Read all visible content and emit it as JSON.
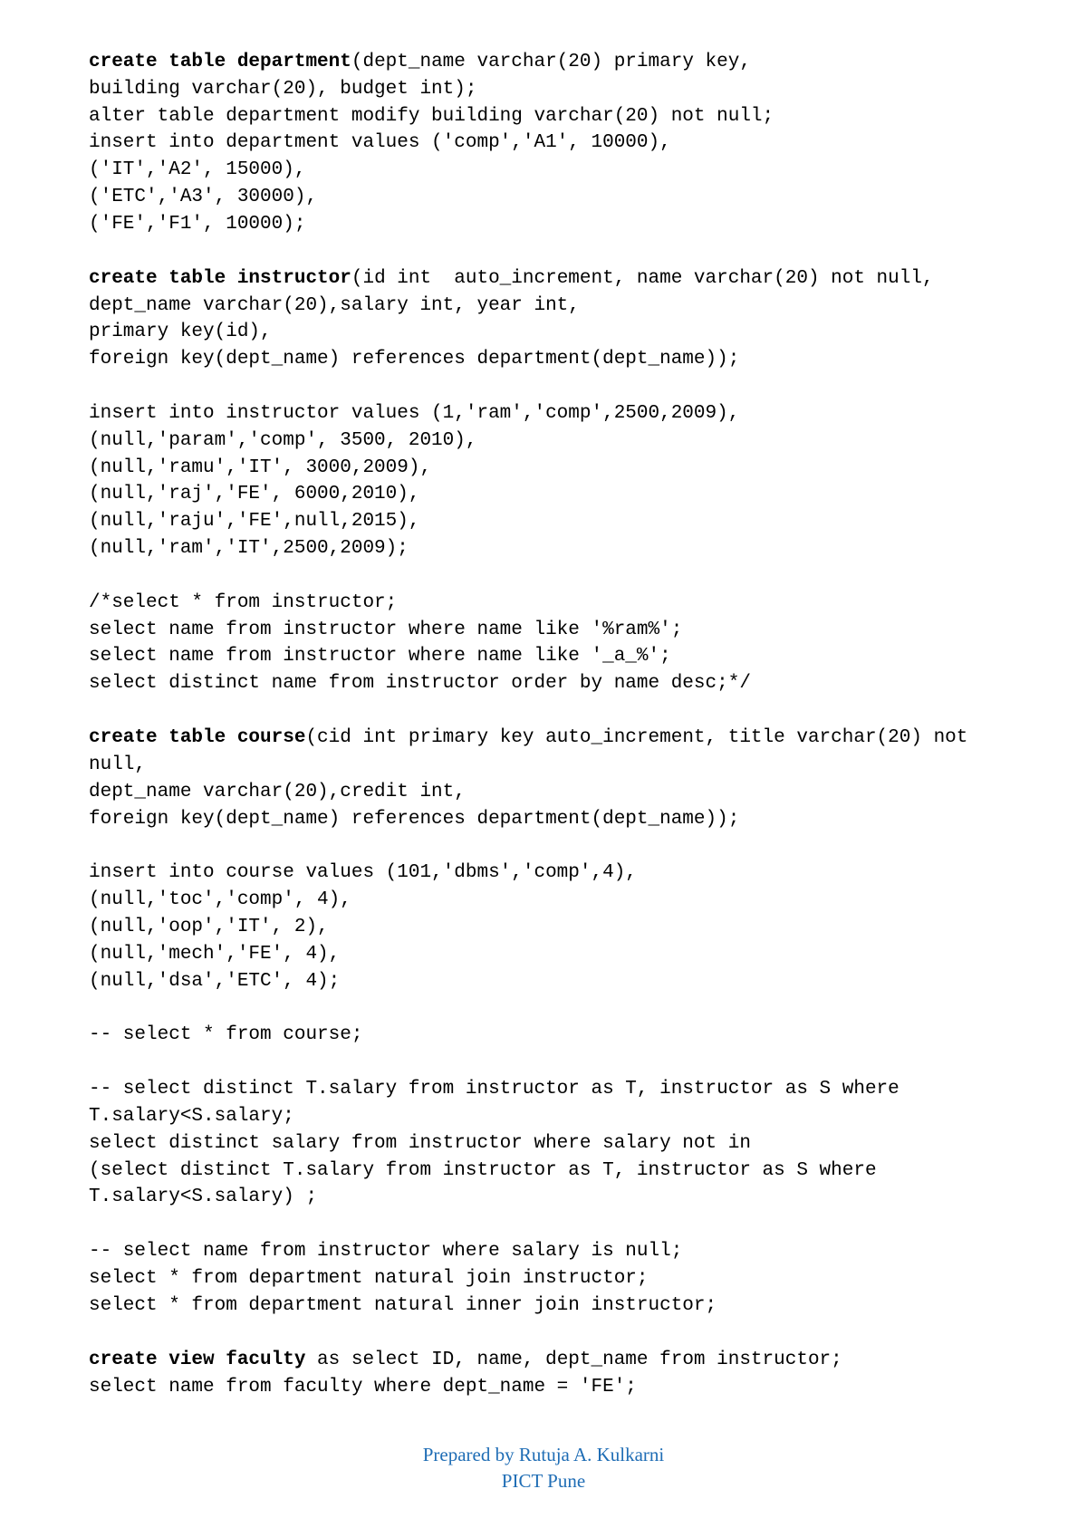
{
  "blocks": {
    "b1_bold": "create table department",
    "b1_rest": "(dept_name varchar(20) primary key,\nbuilding varchar(20), budget int);\nalter table department modify building varchar(20) not null;\ninsert into department values ('comp','A1', 10000),\n('IT','A2', 15000),\n('ETC','A3', 30000),\n('FE','F1', 10000);",
    "b2_bold": "create table instructor",
    "b2_rest": "(id int  auto_increment, name varchar(20) not null,\ndept_name varchar(20),salary int, year int,\nprimary key(id),\nforeign key(dept_name) references department(dept_name));",
    "b3": "insert into instructor values (1,'ram','comp',2500,2009),\n(null,'param','comp', 3500, 2010),\n(null,'ramu','IT', 3000,2009),\n(null,'raj','FE', 6000,2010),\n(null,'raju','FE',null,2015),\n(null,'ram','IT',2500,2009);",
    "b4": "/*select * from instructor;\nselect name from instructor where name like '%ram%';\nselect name from instructor where name like '_a_%';\nselect distinct name from instructor order by name desc;*/",
    "b5_bold": "create table course",
    "b5_rest": "(cid int primary key auto_increment, title varchar(20) not null,\ndept_name varchar(20),credit int,\nforeign key(dept_name) references department(dept_name));",
    "b6": "insert into course values (101,'dbms','comp',4),\n(null,'toc','comp', 4),\n(null,'oop','IT', 2),\n(null,'mech','FE', 4),\n(null,'dsa','ETC', 4);",
    "b7": "-- select * from course;",
    "b8": "-- select distinct T.salary from instructor as T, instructor as S where T.salary<S.salary;\nselect distinct salary from instructor where salary not in\n(select distinct T.salary from instructor as T, instructor as S where\nT.salary<S.salary) ;",
    "b9": "-- select name from instructor where salary is null;\nselect * from department natural join instructor;\nselect * from department natural inner join instructor;",
    "b10_bold": "create view faculty",
    "b10_rest": " as select ID, name, dept_name from instructor;\nselect name from faculty where dept_name = 'FE';"
  },
  "footer": {
    "line1": "Prepared by Rutuja A. Kulkarni",
    "line2": "PICT Pune"
  }
}
